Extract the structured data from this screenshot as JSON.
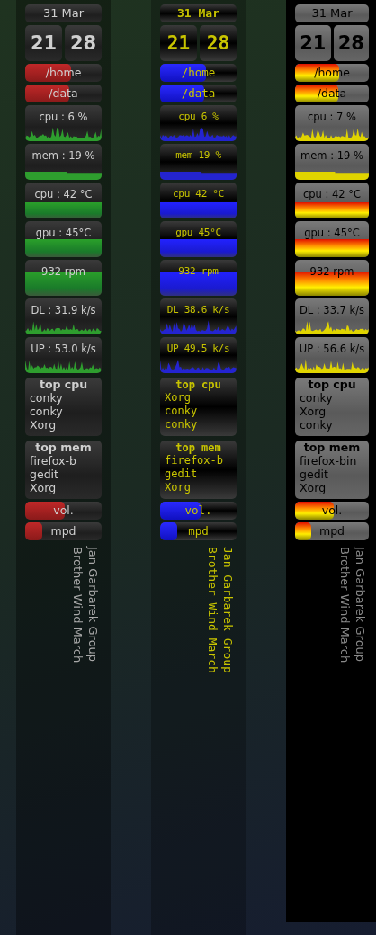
{
  "columns": [
    {
      "kind": "classic",
      "date": "31 Mar",
      "hour": "21",
      "minute": "28",
      "disks": [
        {
          "label": "/home",
          "level": 0.6
        },
        {
          "label": "/data",
          "level": 0.58
        }
      ],
      "meters": [
        {
          "kind": "spikes",
          "label": "cpu : 6 %"
        },
        {
          "kind": "step",
          "label": "mem : 19 %"
        },
        {
          "kind": "flat",
          "label": "cpu : 42 °C"
        },
        {
          "kind": "flat",
          "label": "gpu : 45°C"
        },
        {
          "kind": "flat",
          "label": "932 rpm"
        },
        {
          "kind": "spikes",
          "label": "DL : 31.9 k/s"
        },
        {
          "kind": "spikes",
          "label": "UP : 53.0 k/s"
        }
      ],
      "panels": [
        {
          "title": "top cpu",
          "items": [
            "conky",
            "conky",
            "Xorg"
          ]
        },
        {
          "title": "top mem",
          "items": [
            "firefox-b",
            "gedit",
            "Xorg"
          ]
        }
      ],
      "bars": [
        {
          "label": "vol.",
          "level": 0.52
        },
        {
          "label": "mpd",
          "level": 0.22
        }
      ],
      "now_playing": {
        "artist": "Jan Garbarek Group",
        "title": "Brother Wind March"
      }
    },
    {
      "kind": "mono",
      "date": "31 Mar",
      "hour": "21",
      "minute": "28",
      "disks": [
        {
          "label": "/home",
          "level": 0.6
        },
        {
          "label": "/data",
          "level": 0.58
        }
      ],
      "meters": [
        {
          "kind": "spikes",
          "label": "cpu 6 %"
        },
        {
          "kind": "step",
          "label": "mem 19 %"
        },
        {
          "kind": "flat",
          "label": "cpu 42 °C"
        },
        {
          "kind": "flat",
          "label": "gpu 45°C"
        },
        {
          "kind": "flat",
          "label": "932 rpm"
        },
        {
          "kind": "spikes",
          "label": "DL 38.6 k/s"
        },
        {
          "kind": "spikes",
          "label": "UP 49.5 k/s"
        }
      ],
      "panels": [
        {
          "title": "top cpu",
          "items": [
            "Xorg",
            "conky",
            "conky"
          ]
        },
        {
          "title": "top mem",
          "items": [
            "firefox-b",
            "gedit",
            "Xorg"
          ]
        }
      ],
      "bars": [
        {
          "label": "vol.",
          "level": 0.53
        },
        {
          "label": "mpd",
          "level": 0.22
        }
      ],
      "now_playing": {
        "artist": "Jan Garbarek Group",
        "title": "Brother Wind March"
      }
    },
    {
      "kind": "flame",
      "date": "31 Mar",
      "hour": "21",
      "minute": "28",
      "disks": [
        {
          "label": "/home",
          "level": 0.6
        },
        {
          "label": "/data",
          "level": 0.58
        }
      ],
      "meters": [
        {
          "kind": "spikes",
          "label": "cpu : 7 %"
        },
        {
          "kind": "step",
          "label": "mem : 19 %"
        },
        {
          "kind": "flat",
          "label": "cpu : 42 °C"
        },
        {
          "kind": "flat",
          "label": "gpu : 45°C"
        },
        {
          "kind": "flat",
          "label": "932 rpm"
        },
        {
          "kind": "spikes",
          "label": "DL : 33.7 k/s"
        },
        {
          "kind": "spikes",
          "label": "UP : 56.6 k/s"
        }
      ],
      "panels": [
        {
          "title": "top cpu",
          "items": [
            "conky",
            "Xorg",
            "conky"
          ]
        },
        {
          "title": "top mem",
          "items": [
            "firefox-bin",
            "gedit",
            "Xorg"
          ]
        }
      ],
      "bars": [
        {
          "label": "vol.",
          "level": 0.52
        },
        {
          "label": "mpd",
          "level": 0.22
        }
      ],
      "now_playing": {
        "artist": "Jan Garbarek Group",
        "title": "Brother Wind March"
      }
    }
  ]
}
